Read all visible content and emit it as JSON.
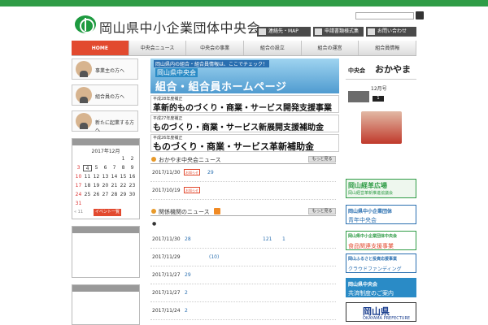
{
  "site": {
    "title": "岡山県中小企業団体中央会"
  },
  "header_links": [
    {
      "label": "連絡先・MAP"
    },
    {
      "label": "申請書類様式集"
    },
    {
      "label": "お問い合わせ"
    }
  ],
  "nav": [
    {
      "label": "HOME"
    },
    {
      "label": "中央会ニュース"
    },
    {
      "label": "中央会の事業"
    },
    {
      "label": "組合の設立"
    },
    {
      "label": "組合の運営"
    },
    {
      "label": "組合員情報"
    }
  ],
  "sidebar": {
    "buttons": [
      {
        "label": "事業主の方へ"
      },
      {
        "label": "組合員の方へ"
      },
      {
        "label": "新たに起業する方へ"
      }
    ],
    "calendar": {
      "month_label": "2017年12月",
      "days": [
        "1",
        "2",
        "3",
        "4",
        "5",
        "6",
        "7",
        "8",
        "9",
        "10",
        "11",
        "12",
        "13",
        "14",
        "15",
        "16",
        "17",
        "18",
        "19",
        "20",
        "21",
        "22",
        "23",
        "24",
        "25",
        "26",
        "27",
        "28",
        "29",
        "30",
        "31"
      ],
      "prev_label": "« 11",
      "event_button": "イベント一覧"
    }
  },
  "main": {
    "banner1": {
      "small": "岡山県内の組合・組合員情報は、ここでチェック！",
      "mid": "岡山県中央会",
      "big": "組合・組合員ホームページ"
    },
    "banner2": {
      "small": "平成28年度補正",
      "big": "革新的ものづくり・商業・サービス開発支援事業"
    },
    "banner3": {
      "small": "平成27年度補正",
      "big": "ものづくり・商業・サービス新展開支援補助金"
    },
    "banner4": {
      "small": "平成26年度補正",
      "big": "ものづくり・商業・サービス革新補助金"
    },
    "news": {
      "title": "おかやま中央会ニュース",
      "more": "もっと見る",
      "rows": [
        {
          "date": "2017/11/30",
          "tag": "お知らせ",
          "value": "29"
        },
        {
          "date": "2017/10/19",
          "tag": "お知らせ",
          "value": ""
        }
      ]
    },
    "related": {
      "title": "関係機関のニュース",
      "more": "もっと見る",
      "bullet": "●",
      "rows": [
        {
          "date": "2017/11/30",
          "v1": "28",
          "v2": "121",
          "v3": "1"
        },
        {
          "date": "2017/11/29",
          "v1": "(10)",
          "v2": "",
          "v3": ""
        },
        {
          "date": "2017/11/27",
          "v1": "29",
          "v2": "",
          "v3": ""
        },
        {
          "date": "2017/11/27",
          "v1": "2",
          "v2": "",
          "v3": ""
        },
        {
          "date": "2017/11/24",
          "v1": "2",
          "v2": "",
          "v3": ""
        }
      ]
    }
  },
  "right": {
    "head_small": "中央会",
    "head_big": "おかやま",
    "issue_label": "12月号",
    "badge": "1",
    "banners": [
      {
        "t1": "岡山経革広場",
        "t2": "岡山経営革新推進協議会"
      },
      {
        "t1": "岡山県中小企業団体",
        "t2": "青年中央会"
      },
      {
        "t1": "岡山県中小企業団体中央会",
        "t2": "食品関連支援事業"
      },
      {
        "t1": "岡山ふるさと投資応援事業",
        "t2": "クラウドファンディング"
      },
      {
        "t1": "岡山県中央会",
        "t2": "共済制度のご案内"
      },
      {
        "t1": "岡山県",
        "t2": "OKAYAMA PREFECTURE"
      }
    ]
  }
}
